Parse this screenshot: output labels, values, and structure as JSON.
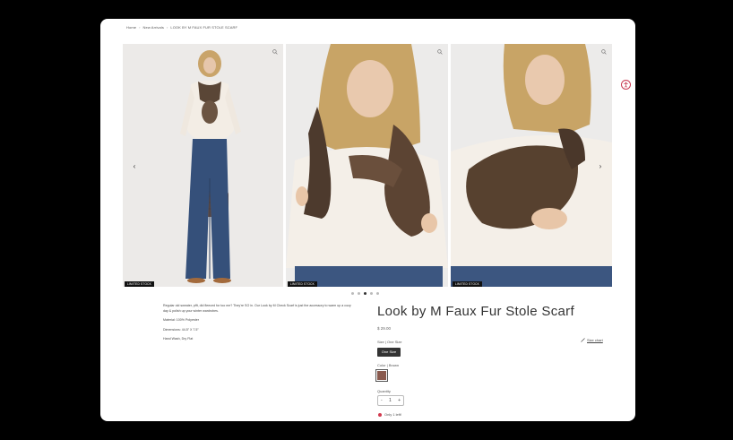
{
  "breadcrumb": [
    "Home",
    "New Arrivals",
    "LOOK BY M FAUX FUR STOLE SCARF"
  ],
  "gallery": {
    "badge_text": "LIMITED STOCK",
    "prev_label": "‹",
    "next_label": "›",
    "slide_count": 5,
    "active_slide": 3
  },
  "product": {
    "title": "Look by M Faux Fur Stole Scarf",
    "price": "$ 29.00",
    "size_label": "Size | One Size",
    "size_option": "One Size",
    "size_guide": "Size chart",
    "color_label": "Color | Brown",
    "swatch_color": "#8a5a4e",
    "quantity_label": "Quantity",
    "quantity_value": "1",
    "qty_minus": "-",
    "qty_plus": "+",
    "stock_note": "Only 1 left!"
  },
  "description": {
    "paragraphs": [
      "Regular old sweater, pfft, did fleeced for too me? They're SO in. Our Look by M Check Scarf is just the accessory to warm up a cozy day & polish up your winter wardrobes.",
      "Material: 100% Polyester",
      "Dimensions: 44.5\" X 7.5\"",
      "Hand Wash, Dry Flat"
    ]
  },
  "colors": {
    "accent": "#c83a52",
    "dark": "#333333"
  }
}
